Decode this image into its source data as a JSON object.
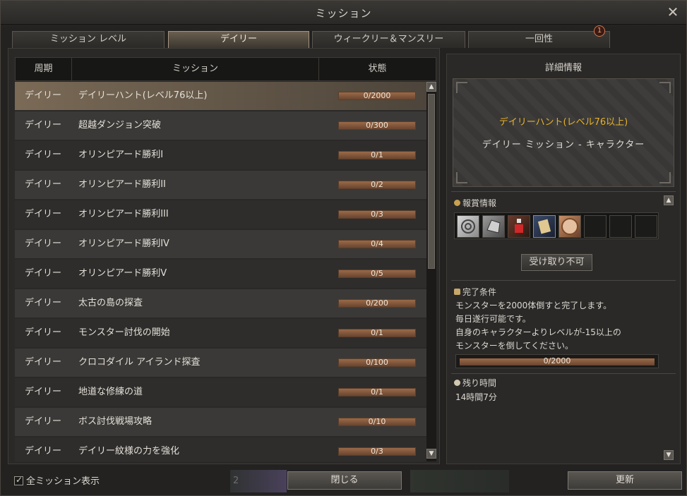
{
  "window": {
    "title": "ミッション",
    "close_icon": "close-icon"
  },
  "tabs": [
    {
      "label": "ミッション レベル",
      "active": false
    },
    {
      "label": "デイリー",
      "active": true
    },
    {
      "label": "ウィークリー＆マンスリー",
      "active": false
    },
    {
      "label": "一回性",
      "active": false,
      "badge": "1"
    }
  ],
  "table": {
    "headers": {
      "period": "周期",
      "mission": "ミッション",
      "status": "状態"
    },
    "rows": [
      {
        "period": "デイリー",
        "name": "デイリーハント(レベル76以上)",
        "progress": "0/2000",
        "selected": true
      },
      {
        "period": "デイリー",
        "name": "超越ダンジョン突破",
        "progress": "0/300"
      },
      {
        "period": "デイリー",
        "name": "オリンピアード勝利I",
        "progress": "0/1"
      },
      {
        "period": "デイリー",
        "name": "オリンピアード勝利II",
        "progress": "0/2"
      },
      {
        "period": "デイリー",
        "name": "オリンピアード勝利III",
        "progress": "0/3"
      },
      {
        "period": "デイリー",
        "name": "オリンピアード勝利IV",
        "progress": "0/4"
      },
      {
        "period": "デイリー",
        "name": "オリンピアード勝利V",
        "progress": "0/5"
      },
      {
        "period": "デイリー",
        "name": "太古の島の探査",
        "progress": "0/200"
      },
      {
        "period": "デイリー",
        "name": "モンスター討伐の開始",
        "progress": "0/1"
      },
      {
        "period": "デイリー",
        "name": "クロコダイル アイランド探査",
        "progress": "0/100"
      },
      {
        "period": "デイリー",
        "name": "地道な修練の道",
        "progress": "0/1"
      },
      {
        "period": "デイリー",
        "name": "ボス討伐戦場攻略",
        "progress": "0/10"
      },
      {
        "period": "デイリー",
        "name": "デイリー紋様の力を強化",
        "progress": "0/3"
      }
    ]
  },
  "detail": {
    "title": "詳細情報",
    "mission_name": "デイリーハント(レベル76以上)",
    "category": "デイリー ミッション - キャラクター",
    "reward_title": "報賞情報",
    "claim_label": "受け取り不可",
    "condition_title": "完了条件",
    "condition_lines": [
      "モンスターを2000体倒すと完了します。",
      "毎日遂行可能です。",
      "自身のキャラクターよりレベルが-15以上の",
      "モンスターを倒してください。"
    ],
    "progress": "0/2000",
    "time_title": "残り時間",
    "time_value": "14時間7分"
  },
  "footer": {
    "show_all_label": "全ミッション表示",
    "show_all_checked": true,
    "close_label": "閉じる",
    "refresh_label": "更新",
    "bg_number": "2"
  },
  "colors": {
    "accent": "#e8b22a",
    "selected_row": "#7a6a56",
    "bar": "#9a6a48"
  }
}
